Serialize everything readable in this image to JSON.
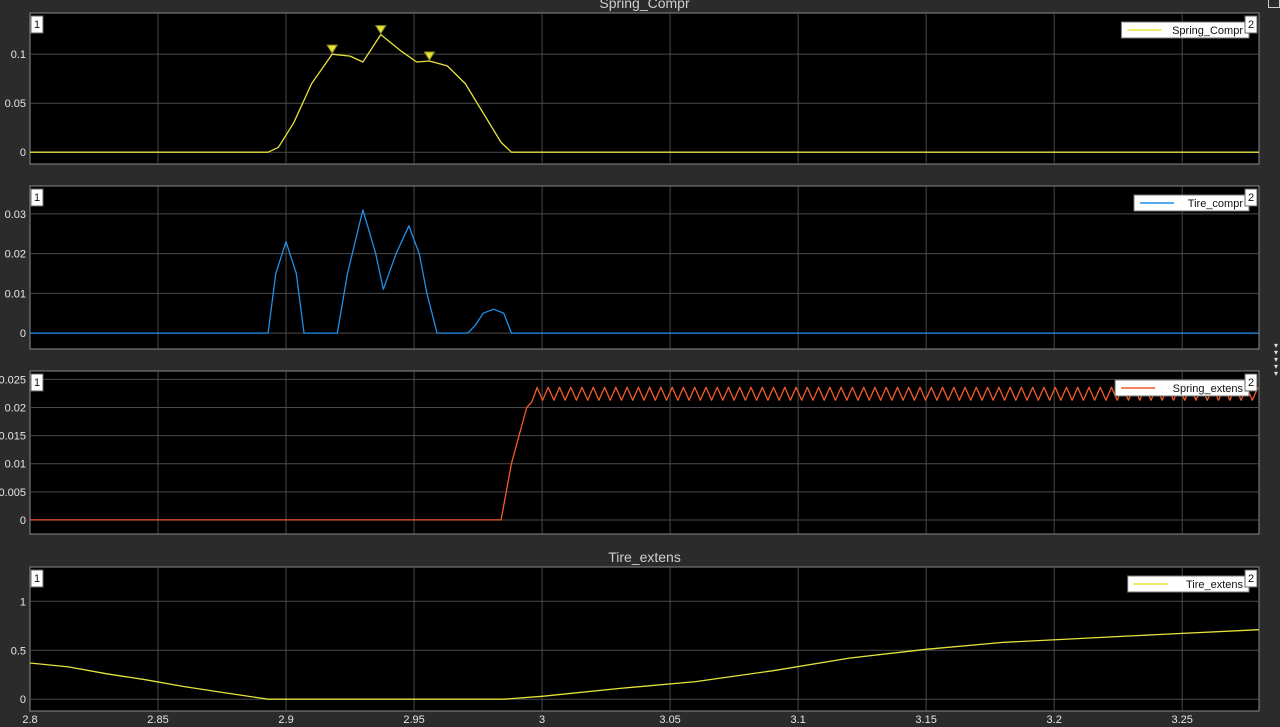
{
  "xticks": [
    "2.8",
    "2.85",
    "2.9",
    "2.95",
    "3",
    "3.05",
    "3.1",
    "3.15",
    "3.2",
    "3.25"
  ],
  "xlim": [
    2.8,
    3.28
  ],
  "colors": {
    "background": "#2b2b2b",
    "plot_bg": "#000000",
    "grid": "#4a4a4a",
    "yellow": "#e6e23a",
    "blue": "#1f8fe8",
    "red": "#f25a2a"
  },
  "chart_data": [
    {
      "type": "line",
      "title": "Spring_Compr",
      "left_badge": "1",
      "right_badge": "2",
      "legend": "Spring_Compr",
      "color": "#e6e23a",
      "ylim": [
        -0.012,
        0.142
      ],
      "yticks": [
        "0",
        "0.05",
        "0.1"
      ],
      "ytick_values": [
        0,
        0.05,
        0.1
      ],
      "markers_x": [
        2.918,
        2.937,
        2.956
      ],
      "x": [
        2.8,
        2.893,
        2.897,
        2.903,
        2.91,
        2.918,
        2.925,
        2.93,
        2.937,
        2.945,
        2.951,
        2.956,
        2.963,
        2.97,
        2.977,
        2.984,
        2.988,
        3.0,
        3.28
      ],
      "y": [
        0,
        0,
        0.005,
        0.03,
        0.07,
        0.1,
        0.098,
        0.092,
        0.12,
        0.103,
        0.092,
        0.093,
        0.088,
        0.07,
        0.04,
        0.01,
        0,
        0,
        0
      ]
    },
    {
      "type": "line",
      "title": "",
      "left_badge": "1",
      "right_badge": "2",
      "legend": "Tire_compr",
      "color": "#1f8fe8",
      "ylim": [
        -0.004,
        0.037
      ],
      "yticks": [
        "0",
        "0.01",
        "0.02",
        "0.03"
      ],
      "ytick_values": [
        0,
        0.01,
        0.02,
        0.03
      ],
      "x": [
        2.8,
        2.893,
        2.896,
        2.9,
        2.904,
        2.907,
        2.911,
        2.92,
        2.924,
        2.93,
        2.935,
        2.938,
        2.943,
        2.948,
        2.952,
        2.955,
        2.959,
        2.971,
        2.974,
        2.977,
        2.981,
        2.985,
        2.988,
        3.0,
        3.28
      ],
      "y": [
        0,
        0,
        0.015,
        0.023,
        0.015,
        0,
        0,
        0,
        0.015,
        0.031,
        0.02,
        0.011,
        0.02,
        0.027,
        0.02,
        0.01,
        0,
        0,
        0.002,
        0.005,
        0.006,
        0.005,
        0,
        0,
        0
      ]
    },
    {
      "type": "line",
      "title": "",
      "left_badge": "1",
      "right_badge": "2",
      "legend": "Spring_extens",
      "color": "#f25a2a",
      "ylim": [
        -0.0025,
        0.0265
      ],
      "yticks": [
        "0",
        "0.005",
        "0.01",
        "0.015",
        "0.02",
        "0.025"
      ],
      "ytick_values": [
        0,
        0.005,
        0.01,
        0.015,
        0.02,
        0.025
      ],
      "x": [
        2.8,
        2.984,
        2.988,
        2.994,
        2.996,
        2.998
      ],
      "y": [
        0,
        0,
        0.01,
        0.02,
        0.021,
        0.0235
      ],
      "oscillation": {
        "x_start": 2.998,
        "x_end": 3.28,
        "period": 0.0044,
        "low": 0.0213,
        "high": 0.0236
      }
    },
    {
      "type": "line",
      "title": "Tire_extens",
      "left_badge": "1",
      "right_badge": "2",
      "legend": "Tire_extens",
      "color": "#e6e23a",
      "ylim": [
        -0.12,
        1.35
      ],
      "yticks": [
        "0",
        "0.5",
        "1"
      ],
      "ytick_values": [
        0,
        0.5,
        1
      ],
      "x": [
        2.8,
        2.815,
        2.83,
        2.845,
        2.86,
        2.875,
        2.893,
        2.9,
        2.92,
        2.95,
        2.985,
        3.0,
        3.03,
        3.06,
        3.09,
        3.12,
        3.15,
        3.18,
        3.21,
        3.24,
        3.28
      ],
      "y": [
        0.37,
        0.33,
        0.26,
        0.2,
        0.13,
        0.07,
        0.0,
        0.0,
        0.0,
        0.0,
        0.0,
        0.03,
        0.11,
        0.18,
        0.29,
        0.42,
        0.51,
        0.58,
        0.62,
        0.66,
        0.71
      ]
    }
  ]
}
